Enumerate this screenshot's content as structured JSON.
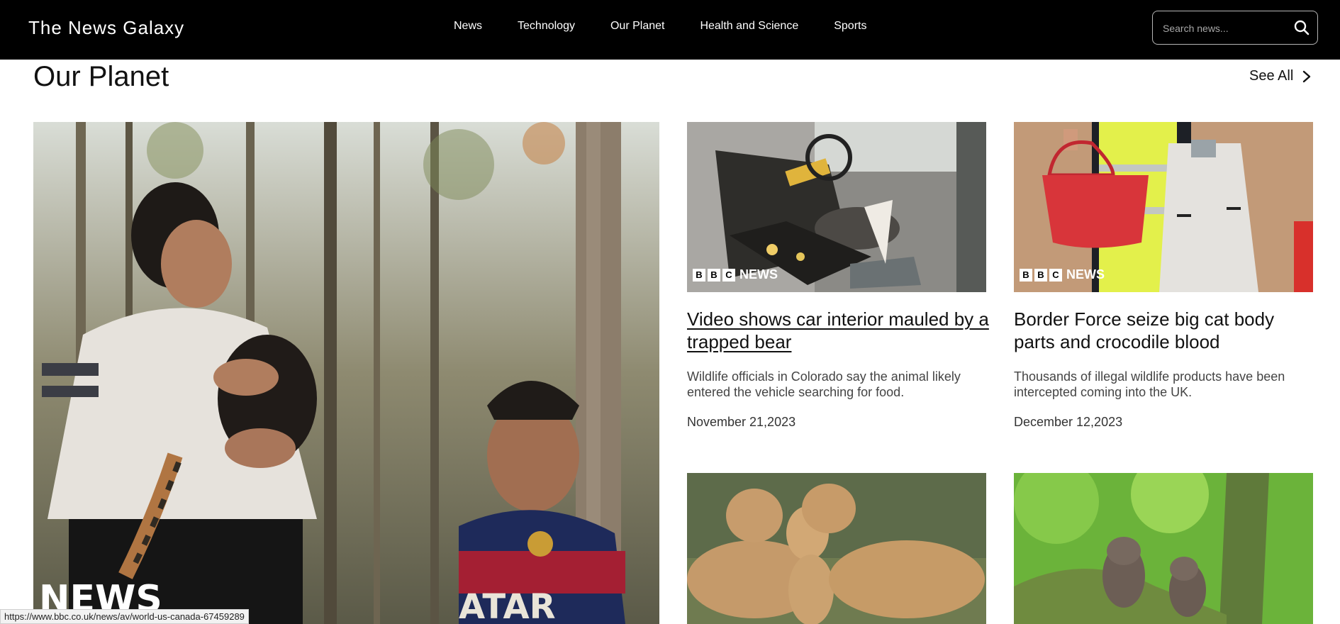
{
  "brand": "The News Galaxy",
  "nav": [
    "News",
    "Technology",
    "Our Planet",
    "Health and Science",
    "Sports"
  ],
  "search": {
    "placeholder": "Search news..."
  },
  "section": {
    "title": "Our Planet",
    "see_all": "See All"
  },
  "feature": {
    "watermark": "NEWS",
    "alt": "Woman holding a small monkey beside a boy in a forest"
  },
  "cards": [
    {
      "title": "Video shows car interior mauled by a trapped bear",
      "description": "Wildlife officials in Colorado say the animal likely entered the vehicle searching for food.",
      "date": "November 21,2023",
      "badge": "NEWS",
      "image": "car interior damaged"
    },
    {
      "title": "Border Force seize big cat body parts and crocodile blood",
      "description": "Thousands of illegal wildlife products have been intercepted coming into the UK.",
      "date": "December 12,2023",
      "badge": "NEWS",
      "image": "officer holding seized handbag and jacket"
    },
    {
      "image": "lioness and cubs"
    },
    {
      "image": "two owls on a mossy tree"
    }
  ],
  "status_bar": {
    "url": "https://www.bbc.co.uk/news/av/world-us-canada-67459289"
  },
  "colors": {
    "header_bg": "#000000",
    "page_bg": "#ffffff",
    "text": "#111111",
    "muted": "#444444"
  }
}
